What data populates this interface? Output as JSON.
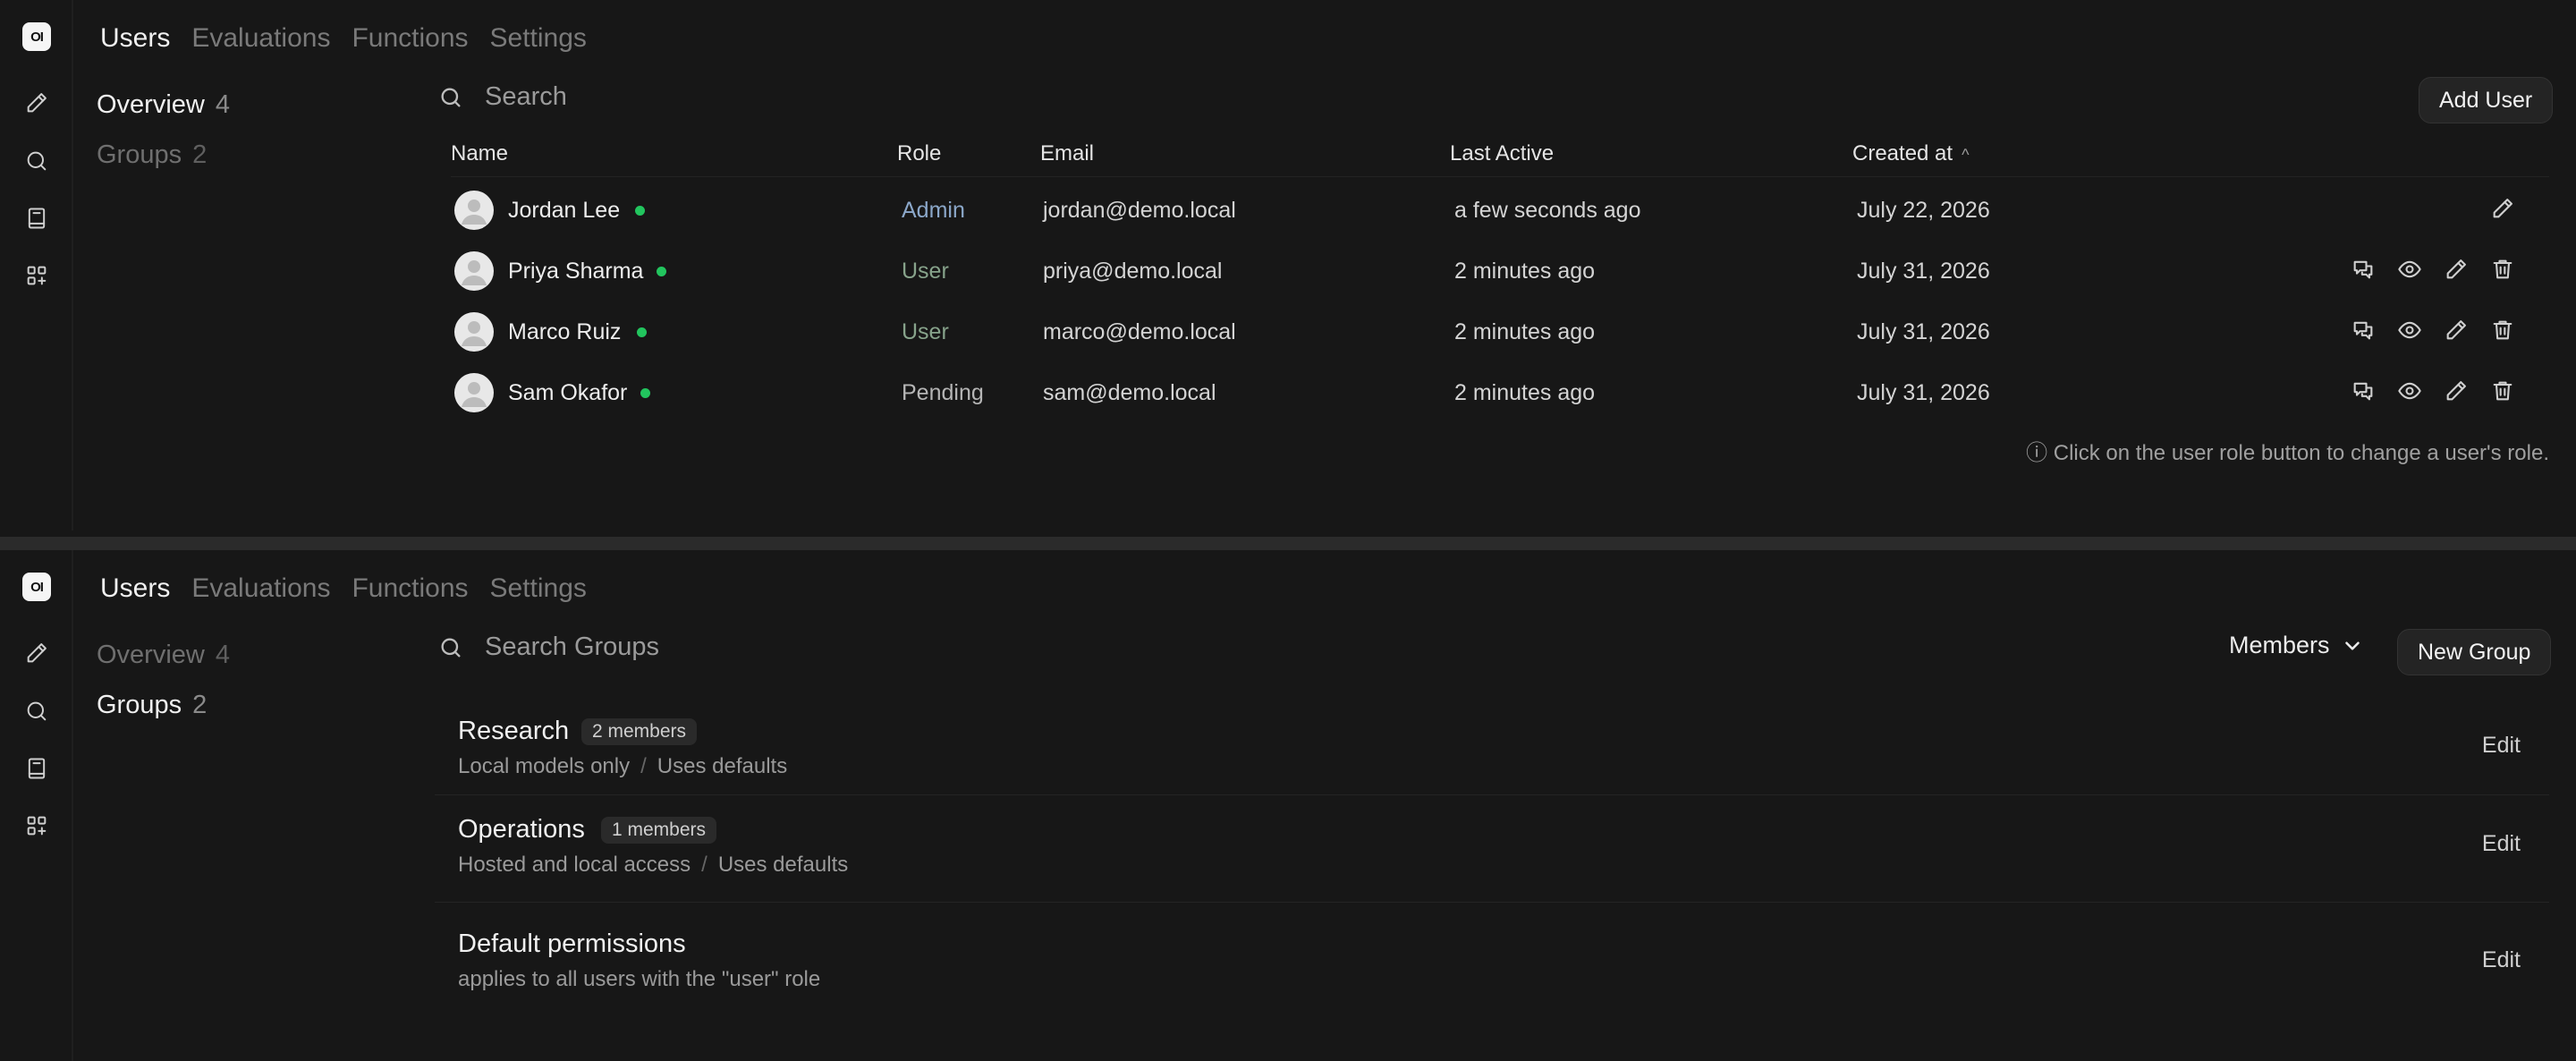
{
  "nav": {
    "logo": "OI",
    "tabs": [
      {
        "label": "Users"
      },
      {
        "label": "Evaluations"
      },
      {
        "label": "Functions"
      },
      {
        "label": "Settings"
      }
    ]
  },
  "users_view": {
    "subnav": [
      {
        "label": "Overview",
        "count": "4"
      },
      {
        "label": "Groups",
        "count": "2"
      }
    ],
    "search": {
      "placeholder": "Search"
    },
    "add_user_label": "Add User",
    "columns": {
      "name": "Name",
      "role": "Role",
      "email": "Email",
      "last_active": "Last Active",
      "created_at": "Created at"
    },
    "rows": [
      {
        "name": "Jordan Lee",
        "role": "Admin",
        "email": "jordan@demo.local",
        "last_active": "a few seconds ago",
        "created_at": "July 22, 2026"
      },
      {
        "name": "Priya Sharma",
        "role": "User",
        "email": "priya@demo.local",
        "last_active": "2 minutes ago",
        "created_at": "July 31, 2026"
      },
      {
        "name": "Marco Ruiz",
        "role": "User",
        "email": "marco@demo.local",
        "last_active": "2 minutes ago",
        "created_at": "July 31, 2026"
      },
      {
        "name": "Sam Okafor",
        "role": "Pending",
        "email": "sam@demo.local",
        "last_active": "2 minutes ago",
        "created_at": "July 31, 2026"
      }
    ],
    "hint": "ⓘ Click on the user role button to change a user's role."
  },
  "groups_view": {
    "subnav": [
      {
        "label": "Overview",
        "count": "4"
      },
      {
        "label": "Groups",
        "count": "2"
      }
    ],
    "search": {
      "placeholder": "Search Groups"
    },
    "filter_label": "Members",
    "new_group_label": "New Group",
    "groups": [
      {
        "name": "Research",
        "badge": "2 members",
        "desc_a": "Local models only",
        "sep": "/",
        "desc_b": "Uses defaults",
        "edit": "Edit"
      },
      {
        "name": "Operations",
        "badge": "1 members",
        "desc_a": "Hosted and local access",
        "sep": "/",
        "desc_b": "Uses defaults",
        "edit": "Edit"
      }
    ],
    "defaults": {
      "title": "Default permissions",
      "desc": "applies to all users with the \"user\" role",
      "edit": "Edit"
    }
  },
  "colors": {
    "background": "#171717",
    "online": "#22c55e",
    "role_admin": "#8ba7c9",
    "role_user": "#87a38b"
  }
}
